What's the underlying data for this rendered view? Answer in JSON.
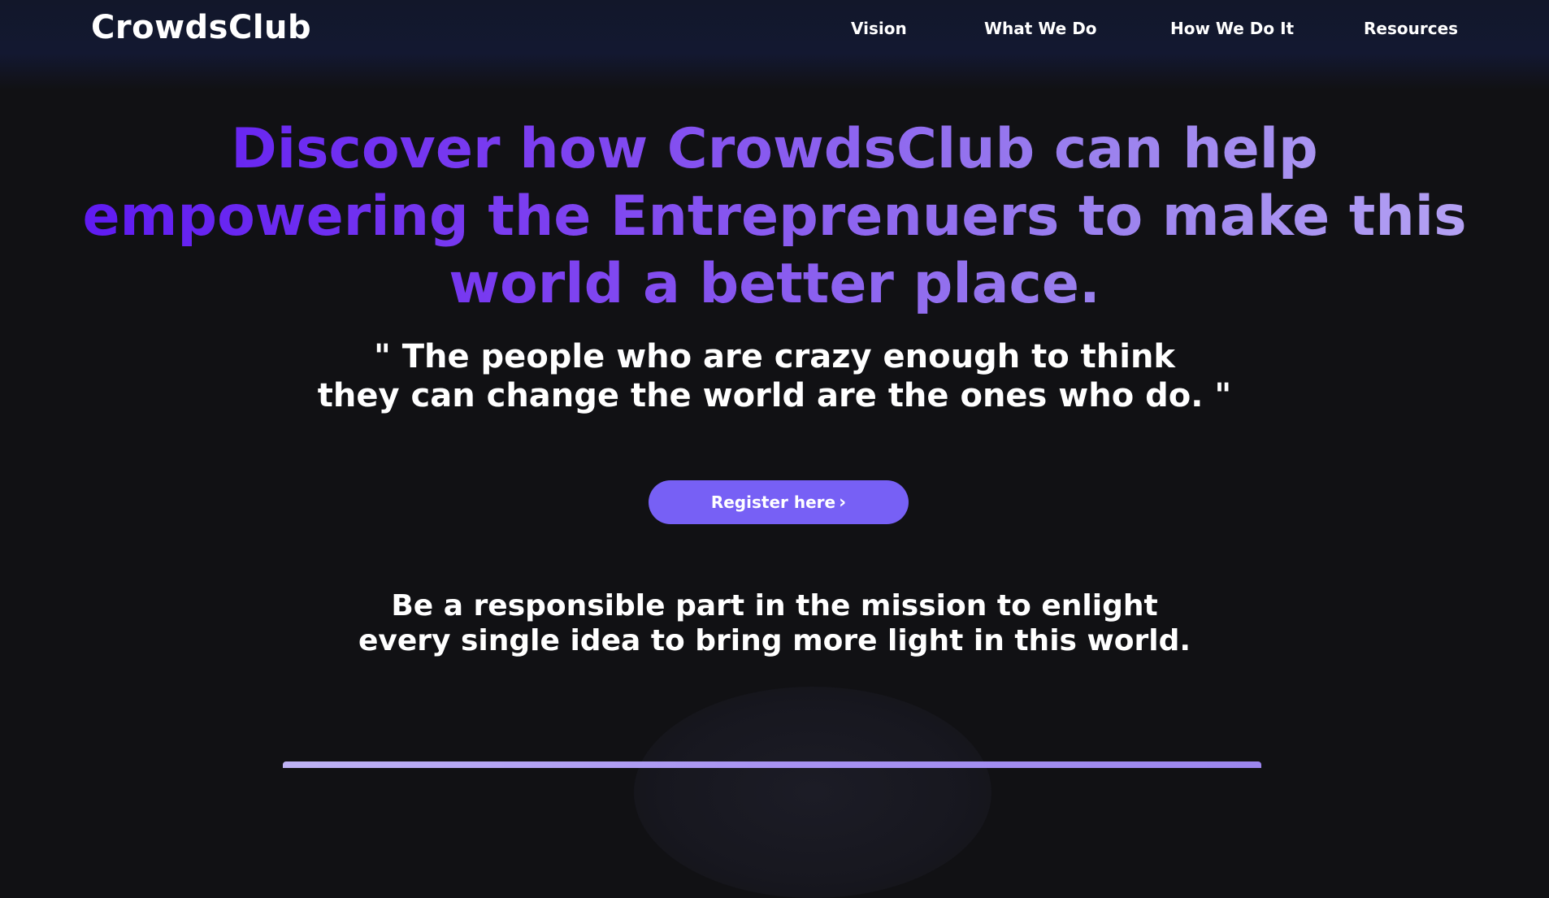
{
  "header": {
    "brand": "CrowdsClub",
    "nav": [
      {
        "label": "Vision"
      },
      {
        "label": "What We Do"
      },
      {
        "label": "How We Do It"
      },
      {
        "label": "Resources"
      }
    ]
  },
  "hero": {
    "headline_lines": [
      "Discover how CrowdsClub can help",
      "empowering the Entreprenuers to make this",
      "world a better place."
    ],
    "quote_lines": [
      "\" The people who are crazy enough to think",
      "they can change the world are the ones who do. \""
    ],
    "register_label": "Register here",
    "register_icon": "chevron-right-icon",
    "mission_lines": [
      "Be a responsible part in the mission to enlight",
      "every single idea to bring more light in this world."
    ]
  },
  "colors": {
    "background": "#111114",
    "header_bg": "#131831",
    "headline_gradient_start": "#5a14f2",
    "headline_gradient_end": "#b9a8f4",
    "button_bg": "#7760f5",
    "text": "#ffffff"
  }
}
